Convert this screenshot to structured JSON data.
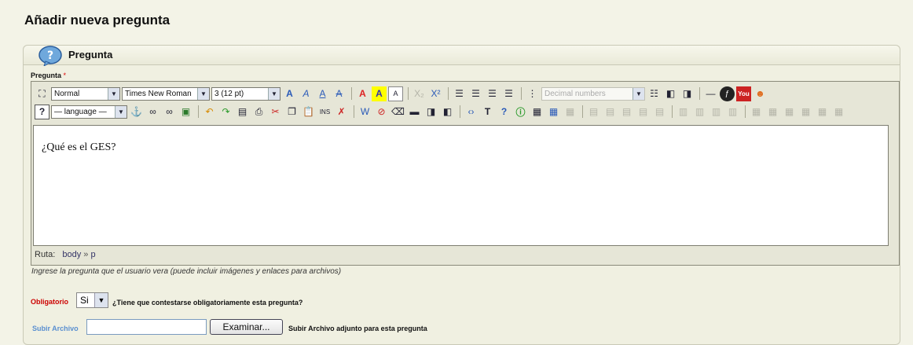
{
  "page": {
    "title": "Añadir nueva pregunta"
  },
  "panel": {
    "title": "Pregunta"
  },
  "question_field": {
    "label": "Pregunta",
    "required_mark": "*",
    "content": "¿Qué es el GES?",
    "help": "Ingrese la pregunta que el usuario vera (puede incluir imágenes y enlaces para archivos)"
  },
  "toolbar": {
    "format_select": "Normal",
    "font_select": "Times New Roman",
    "size_select": "3 (12 pt)",
    "list_select": "Decimal numbers",
    "language_select": "— language —"
  },
  "statusbar": {
    "label": "Ruta:",
    "path_body": "body",
    "sep": "»",
    "path_p": "p"
  },
  "required": {
    "label": "Obligatorio",
    "value": "Si",
    "description": "¿Tiene que contestarse obligatoriamente esta pregunta?"
  },
  "upload": {
    "label": "Subir Archivo",
    "button": "Examinar...",
    "description": "Subir Archivo adjunto para esta pregunta"
  },
  "colors": {
    "background": "#f3f3e7",
    "required_label": "#cc0000",
    "upload_label": "#5a8fd0",
    "required_star": "#dd0000"
  }
}
